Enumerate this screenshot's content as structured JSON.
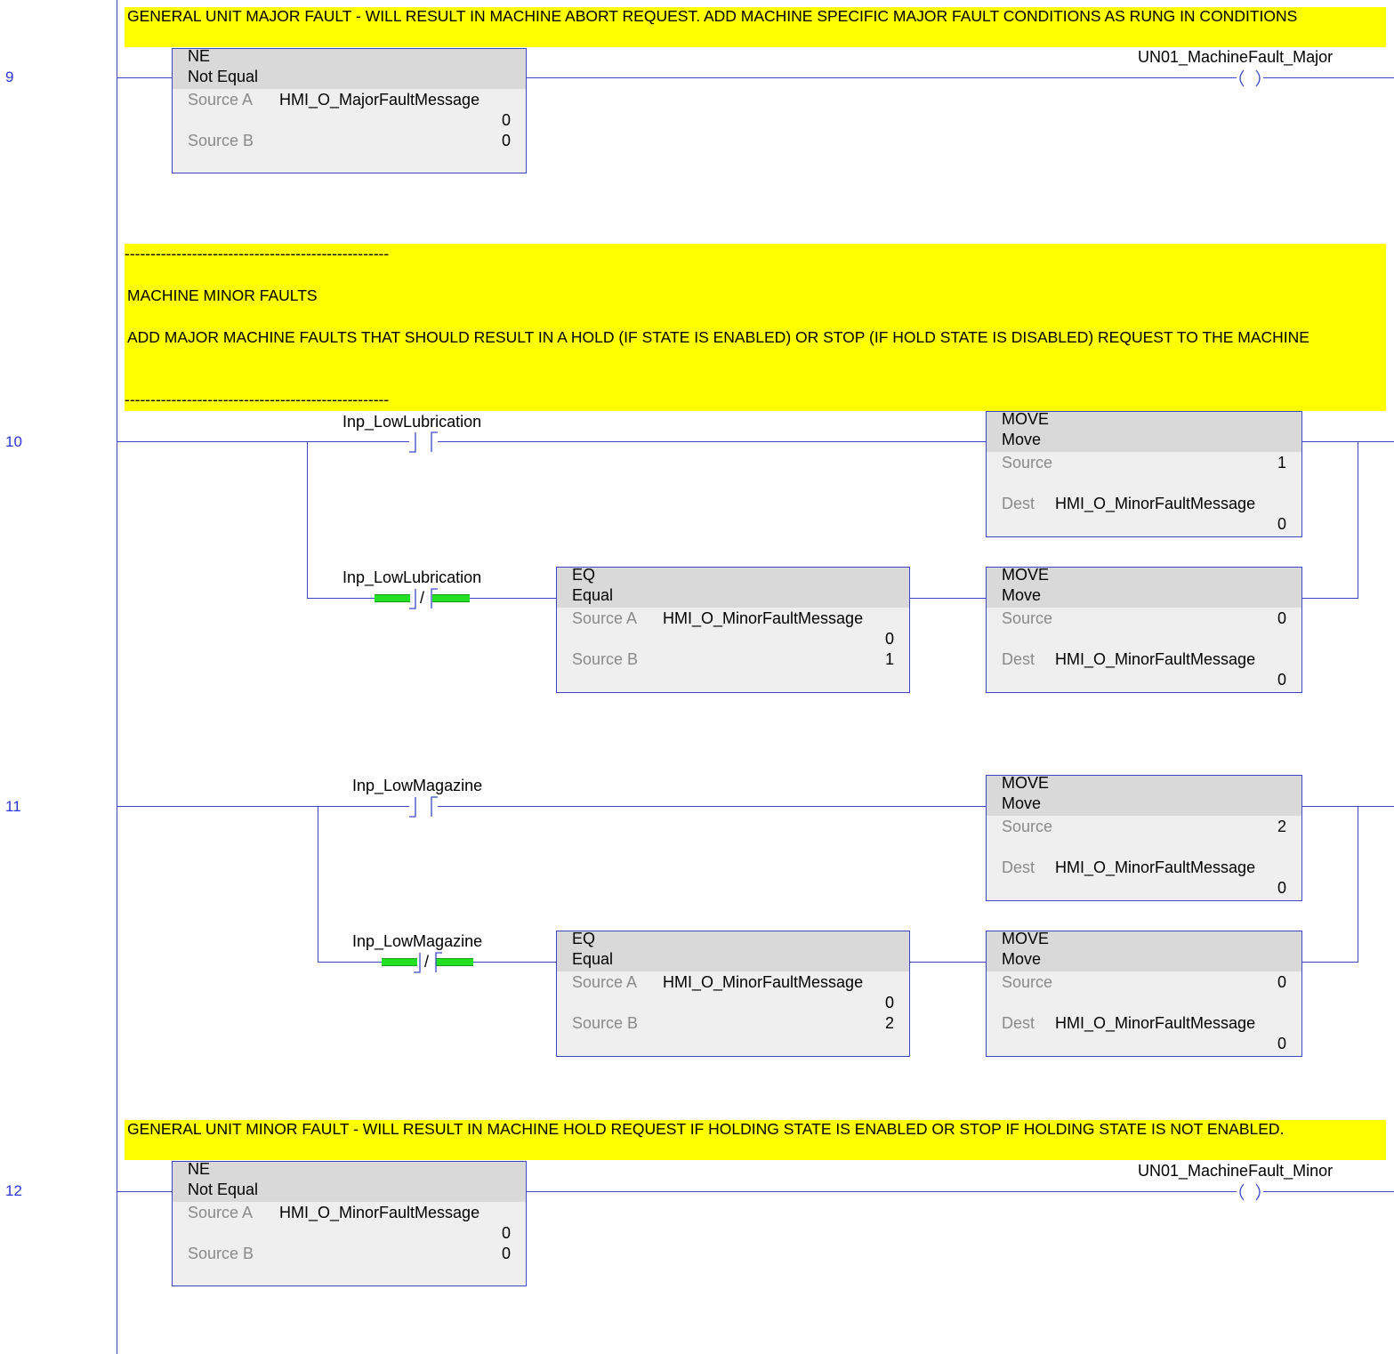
{
  "comments": {
    "c9": "GENERAL UNIT MAJOR FAULT - WILL RESULT IN MACHINE ABORT REQUEST.  ADD MACHINE SPECIFIC MAJOR FAULT CONDITIONS AS RUNG IN CONDITIONS",
    "c10_dashes": "---------------------------------------------------",
    "c10_title": "MACHINE MINOR FAULTS",
    "c10_body": "ADD MAJOR MACHINE FAULTS THAT SHOULD RESULT IN A HOLD (IF STATE IS ENABLED) OR STOP (IF HOLD STATE IS DISABLED) REQUEST  TO THE MACHINE",
    "c12": "GENERAL UNIT MINOR FAULT - WILL RESULT IN MACHINE HOLD REQUEST IF HOLDING STATE IS ENABLED OR STOP IF HOLDING STATE IS NOT ENABLED."
  },
  "rungs": {
    "r9": {
      "number": "9",
      "ne": {
        "mnemonic": "NE",
        "name": "Not Equal",
        "srcA_label": "Source A",
        "srcA_tag": "HMI_O_MajorFaultMessage",
        "srcA_value": "0",
        "srcB_label": "Source B",
        "srcB_value": "0"
      },
      "coil": "UN01_MachineFault_Major"
    },
    "r10": {
      "number": "10",
      "xic": "Inp_LowLubrication",
      "xio": "Inp_LowLubrication",
      "xio_symbol": "/",
      "eq": {
        "mnemonic": "EQ",
        "name": "Equal",
        "srcA_label": "Source A",
        "srcA_tag": "HMI_O_MinorFaultMessage",
        "srcA_value": "0",
        "srcB_label": "Source B",
        "srcB_value": "1"
      },
      "mov1": {
        "mnemonic": "MOVE",
        "name": "Move",
        "src_label": "Source",
        "src_value": "1",
        "dest_label": "Dest",
        "dest_tag": "HMI_O_MinorFaultMessage",
        "dest_value": "0"
      },
      "mov2": {
        "mnemonic": "MOVE",
        "name": "Move",
        "src_label": "Source",
        "src_value": "0",
        "dest_label": "Dest",
        "dest_tag": "HMI_O_MinorFaultMessage",
        "dest_value": "0"
      }
    },
    "r11": {
      "number": "11",
      "xic": "Inp_LowMagazine",
      "xio": "Inp_LowMagazine",
      "xio_symbol": "/",
      "eq": {
        "mnemonic": "EQ",
        "name": "Equal",
        "srcA_label": "Source A",
        "srcA_tag": "HMI_O_MinorFaultMessage",
        "srcA_value": "0",
        "srcB_label": "Source B",
        "srcB_value": "2"
      },
      "mov1": {
        "mnemonic": "MOVE",
        "name": "Move",
        "src_label": "Source",
        "src_value": "2",
        "dest_label": "Dest",
        "dest_tag": "HMI_O_MinorFaultMessage",
        "dest_value": "0"
      },
      "mov2": {
        "mnemonic": "MOVE",
        "name": "Move",
        "src_label": "Source",
        "src_value": "0",
        "dest_label": "Dest",
        "dest_tag": "HMI_O_MinorFaultMessage",
        "dest_value": "0"
      }
    },
    "r12": {
      "number": "12",
      "ne": {
        "mnemonic": "NE",
        "name": "Not Equal",
        "srcA_label": "Source A",
        "srcA_tag": "HMI_O_MinorFaultMessage",
        "srcA_value": "0",
        "srcB_label": "Source B",
        "srcB_value": "0"
      },
      "coil": "UN01_MachineFault_Minor"
    }
  },
  "colors": {
    "wire": "#3b48c6",
    "comment_bg": "#ffff00",
    "powerflow": "#22e022",
    "rung_number": "#2a35d6"
  }
}
